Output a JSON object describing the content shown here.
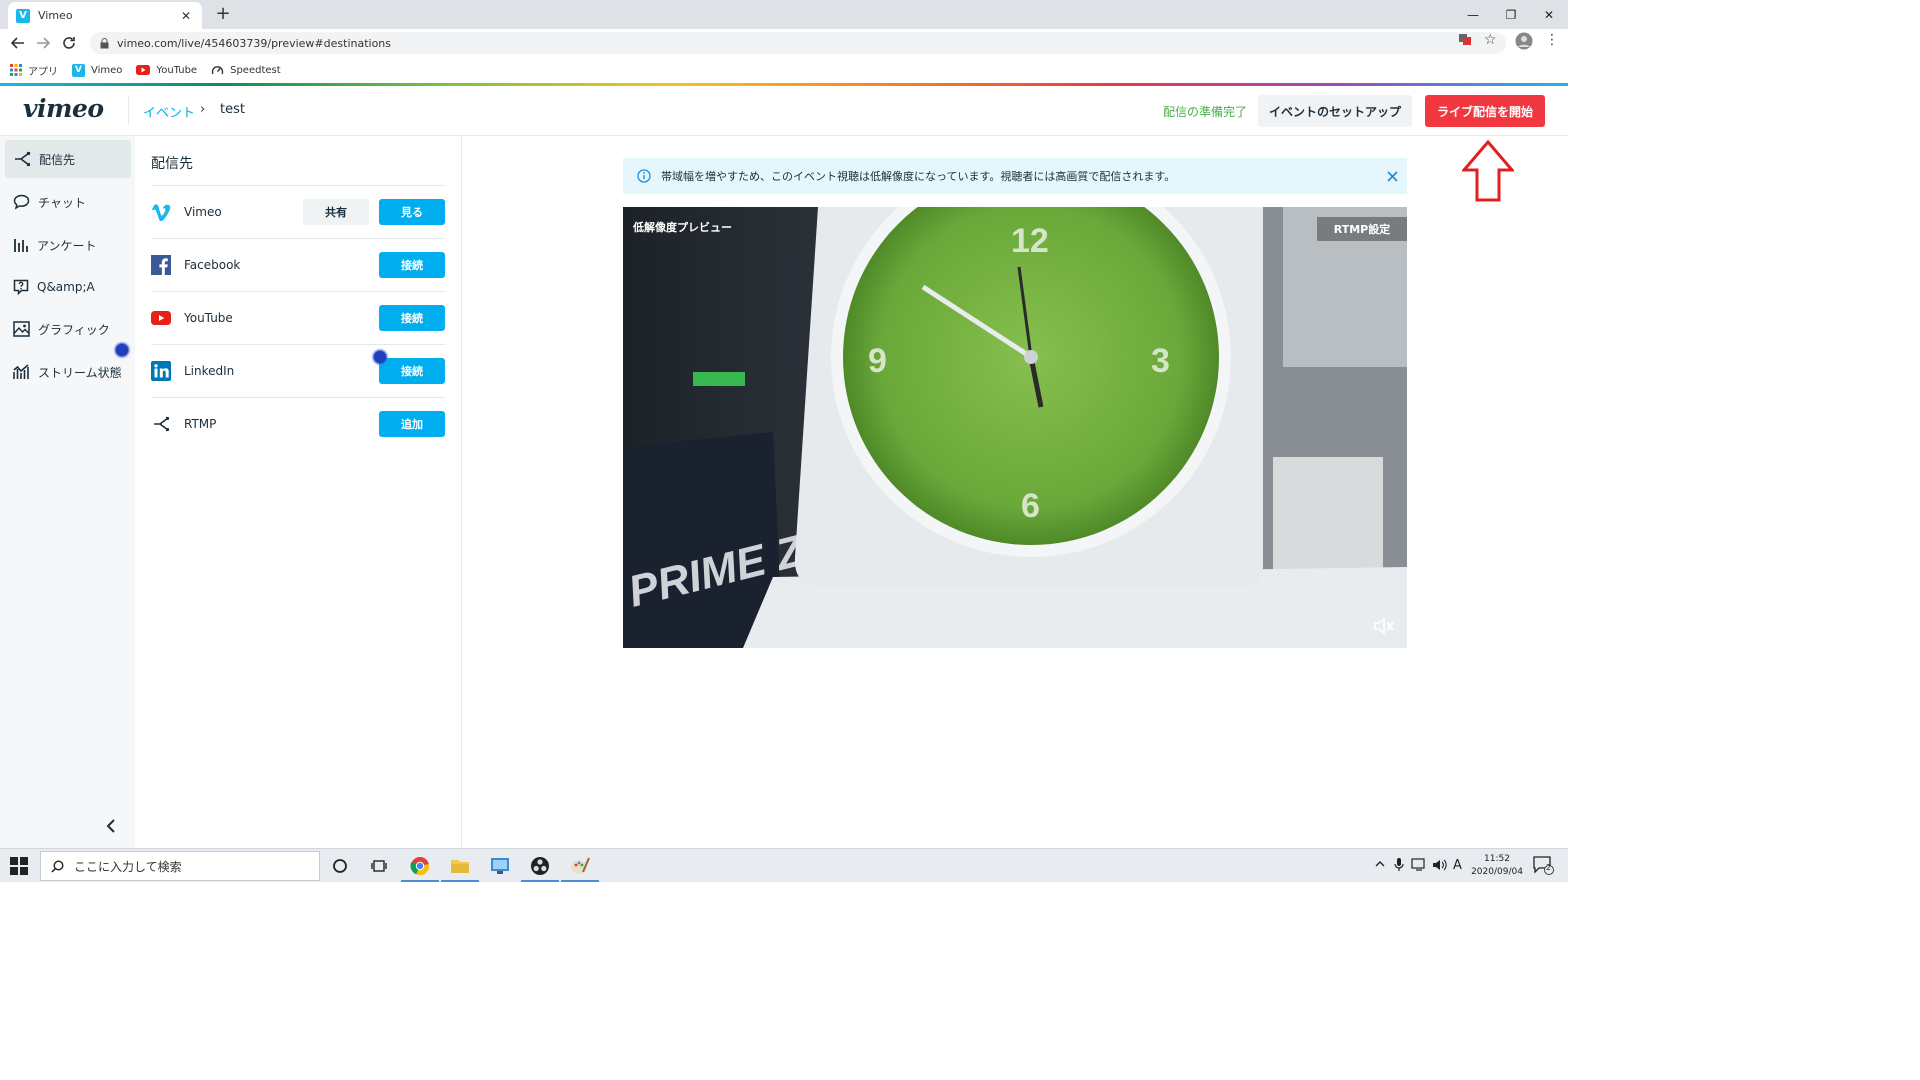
{
  "browser": {
    "tab_title": "Vimeo",
    "tab_favicon": "V",
    "url": "vimeo.com/live/454603739/preview#destinations",
    "bookmarks": [
      {
        "label": "アプリ",
        "icon": "apps-grid-icon"
      },
      {
        "label": "Vimeo",
        "icon": "vimeo-icon"
      },
      {
        "label": "YouTube",
        "icon": "youtube-icon"
      },
      {
        "label": "Speedtest",
        "icon": "speedtest-icon"
      }
    ]
  },
  "header": {
    "logo": "vimeo",
    "breadcrumb_event": "イベント",
    "breadcrumb_sep": "›",
    "breadcrumb_current": "test",
    "status": "配信の準備完了",
    "setup_button": "イベントのセットアップ",
    "live_button": "ライブ配信を開始"
  },
  "sidebar": {
    "items": [
      {
        "label": "配信先",
        "icon": "destinations-icon"
      },
      {
        "label": "チャット",
        "icon": "chat-icon"
      },
      {
        "label": "アンケート",
        "icon": "poll-icon"
      },
      {
        "label": "Q&amp;A",
        "icon": "qa-icon"
      },
      {
        "label": "グラフィック",
        "icon": "graphics-icon"
      },
      {
        "label": "ストリーム状態",
        "icon": "stream-health-icon"
      }
    ]
  },
  "destinations": {
    "title": "配信先",
    "rows": [
      {
        "name": "Vimeo",
        "secondary": "共有",
        "action": "見る"
      },
      {
        "name": "Facebook",
        "action": "接続"
      },
      {
        "name": "YouTube",
        "action": "接続"
      },
      {
        "name": "LinkedIn",
        "action": "接続"
      },
      {
        "name": "RTMP",
        "action": "追加"
      }
    ]
  },
  "notice": {
    "text": "帯域幅を増やすため、このイベント視聴は低解像度になっています。視聴者には高画質で配信されます。"
  },
  "preview": {
    "label": "低解像度プレビュー",
    "rtmp_button": "RTMP設定"
  },
  "taskbar": {
    "search_placeholder": "ここに入力して検索",
    "ime": "A",
    "time": "11:52",
    "date": "2020/09/04",
    "notification_count": "2"
  },
  "colors": {
    "vimeo_blue": "#00adef",
    "live_red": "#f1373f",
    "ready_green": "#4cae4c",
    "annotation_red": "#e02020"
  }
}
